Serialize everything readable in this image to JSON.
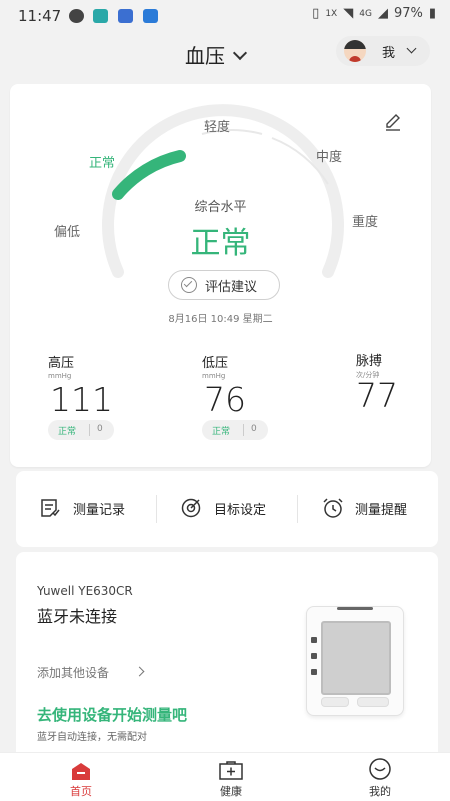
{
  "status_bar": {
    "time": "11:47",
    "battery": "97%",
    "network": "4G",
    "network_sub": "1X"
  },
  "header": {
    "title": "血压",
    "user_name": "我"
  },
  "gauge": {
    "levels": [
      "偏低",
      "正常",
      "轻度",
      "中度",
      "重度"
    ],
    "active_level": "正常",
    "center_label": "综合水平",
    "center_value": "正常",
    "accent_color": "#35b57a"
  },
  "assess_button": "评估建议",
  "datetime": "8月16日 10:49 星期二",
  "metrics": [
    {
      "label": "高压",
      "unit": "mmHg",
      "value": "111",
      "status": "正常",
      "count": "0"
    },
    {
      "label": "低压",
      "unit": "mmHg",
      "value": "76",
      "status": "正常",
      "count": "0"
    },
    {
      "label": "脉搏",
      "unit": "次/分钟",
      "value": "77"
    }
  ],
  "actions": [
    {
      "label": "测量记录",
      "icon": "record-icon"
    },
    {
      "label": "目标设定",
      "icon": "target-icon"
    },
    {
      "label": "测量提醒",
      "icon": "alarm-icon"
    }
  ],
  "device": {
    "model": "Yuwell YE630CR",
    "status": "蓝牙未连接",
    "add_device": "添加其他设备",
    "cta": "去使用设备开始测量吧",
    "note": "蓝牙自动连接，无需配对"
  },
  "nav": [
    {
      "label": "首页",
      "icon": "home-icon",
      "active": true
    },
    {
      "label": "健康",
      "icon": "health-icon",
      "active": false
    },
    {
      "label": "我的",
      "icon": "profile-icon",
      "active": false
    }
  ]
}
